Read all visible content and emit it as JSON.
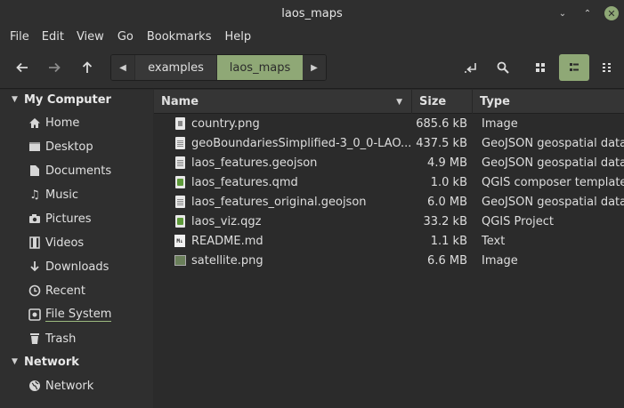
{
  "window": {
    "title": "laos_maps"
  },
  "menu": [
    "File",
    "Edit",
    "View",
    "Go",
    "Bookmarks",
    "Help"
  ],
  "breadcrumbs": [
    "examples",
    "laos_maps"
  ],
  "sidebar": {
    "sections": [
      {
        "label": "My Computer",
        "items": [
          {
            "label": "Home",
            "icon": "home-icon"
          },
          {
            "label": "Desktop",
            "icon": "desktop-icon"
          },
          {
            "label": "Documents",
            "icon": "documents-icon"
          },
          {
            "label": "Music",
            "icon": "music-icon"
          },
          {
            "label": "Pictures",
            "icon": "camera-icon"
          },
          {
            "label": "Videos",
            "icon": "film-icon"
          },
          {
            "label": "Downloads",
            "icon": "download-icon"
          },
          {
            "label": "Recent",
            "icon": "clock-icon"
          },
          {
            "label": "File System",
            "icon": "drive-icon"
          },
          {
            "label": "Trash",
            "icon": "trash-icon"
          }
        ]
      },
      {
        "label": "Network",
        "items": [
          {
            "label": "Network",
            "icon": "globe-icon"
          }
        ]
      }
    ]
  },
  "columns": {
    "name": "Name",
    "size": "Size",
    "type": "Type"
  },
  "files": [
    {
      "name": "country.png",
      "size": "685.6 kB",
      "type": "Image",
      "icon": "png-file-icon"
    },
    {
      "name": "geoBoundariesSimplified-3_0_0-LAO...",
      "size": "437.5 kB",
      "type": "GeoJSON geospatial data",
      "icon": "text-file-icon"
    },
    {
      "name": "laos_features.geojson",
      "size": "4.9 MB",
      "type": "GeoJSON geospatial data",
      "icon": "text-file-icon"
    },
    {
      "name": "laos_features.qmd",
      "size": "1.0 kB",
      "type": "QGIS composer template",
      "icon": "qgis-file-icon"
    },
    {
      "name": "laos_features_original.geojson",
      "size": "6.0 MB",
      "type": "GeoJSON geospatial data",
      "icon": "text-file-icon"
    },
    {
      "name": "laos_viz.qgz",
      "size": "33.2 kB",
      "type": "QGIS Project",
      "icon": "qgis-project-icon"
    },
    {
      "name": "README.md",
      "size": "1.1 kB",
      "type": "Text",
      "icon": "markdown-file-icon"
    },
    {
      "name": "satellite.png",
      "size": "6.6 MB",
      "type": "Image",
      "icon": "image-thumbnail-icon"
    }
  ],
  "colors": {
    "accent": "#8fa876",
    "background": "#2b2b2b",
    "sidebar": "#2f2f2f"
  }
}
